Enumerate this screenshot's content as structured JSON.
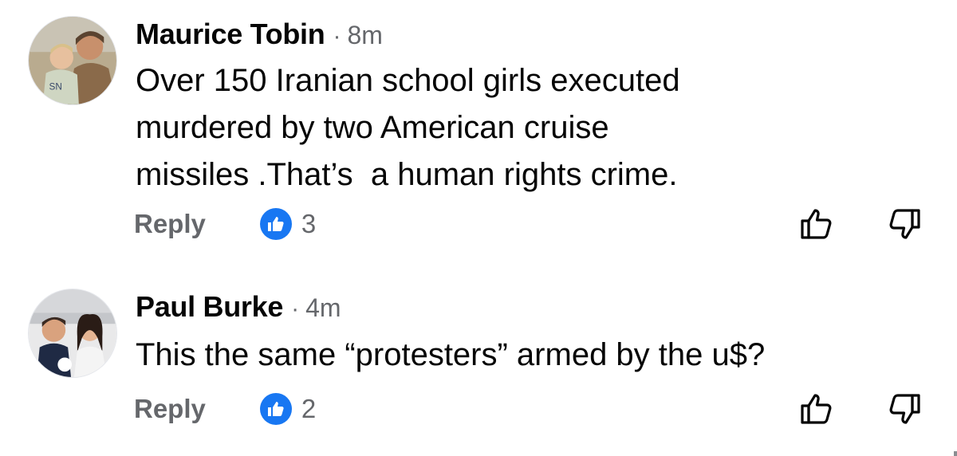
{
  "comments": [
    {
      "author": "Maurice Tobin",
      "separator": "·",
      "time": "8m",
      "text": "Over 150 Iranian school girls executed\nmurdered by two American cruise\nmissiles .That’s  a human rights crime.",
      "reply_label": "Reply",
      "like_count": "3",
      "avatar_icon": "profile-photo"
    },
    {
      "author": "Paul Burke",
      "separator": "·",
      "time": "4m",
      "text": "This the same “protesters” armed by the u$?",
      "reply_label": "Reply",
      "like_count": "2",
      "avatar_icon": "profile-photo"
    }
  ],
  "colors": {
    "like_blue": "#1877f2",
    "secondary_text": "#65676b",
    "primary_text": "#050505"
  },
  "icons": {
    "reaction": "like-thumb-icon",
    "upvote": "thumbs-up-outline-icon",
    "downvote": "thumbs-down-outline-icon"
  }
}
